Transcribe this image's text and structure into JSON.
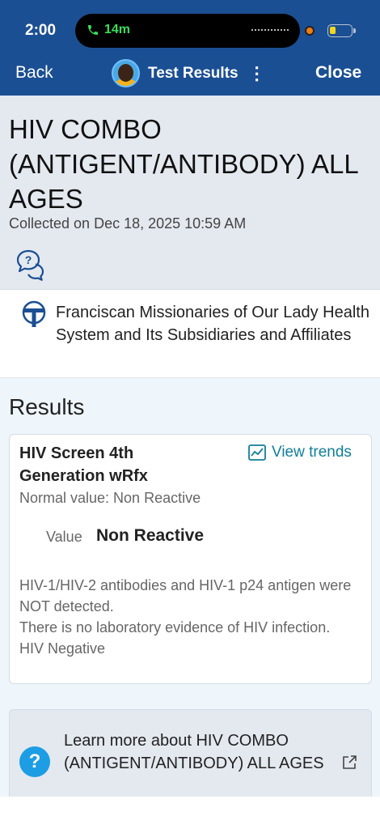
{
  "status_bar": {
    "time": "2:00",
    "call_duration": "14m",
    "icons": [
      "phone-icon",
      "camera-indicator",
      "battery-icon"
    ]
  },
  "nav": {
    "back_label": "Back",
    "title": "Test Results",
    "more_icon": "kebab-menu-icon",
    "close_label": "Close"
  },
  "test": {
    "title": "HIV COMBO (ANTIGENT/ANTIBODY) ALL AGES",
    "collected": "Collected on Dec 18, 2025 10:59 AM",
    "help_icon": "question-chat-icon"
  },
  "organization": {
    "name": "Franciscan Missionaries of Our Lady Health System and Its Subsidiaries and Affiliates",
    "logo_icon": "tau-cross-logo"
  },
  "results": {
    "heading": "Results",
    "components": [
      {
        "name": "HIV Screen 4th Generation wRfx",
        "trends_label": "View trends",
        "normal_value": "Normal value: Non Reactive",
        "value_label": "Value",
        "value": "Non Reactive",
        "comment_lines": [
          "HIV-1/HIV-2 antibodies and HIV-1 p24 antigen were NOT detected.",
          "There is no laboratory evidence of HIV infection.",
          "HIV Negative"
        ]
      }
    ]
  },
  "learn_more": {
    "text": "Learn more about HIV COMBO (ANTIGENT/ANTIBODY) ALL AGES",
    "icon": "question-circle-icon",
    "external_icon": "external-link-icon"
  },
  "colors": {
    "header_bg": "#1b4f93",
    "accent_teal": "#0f7f98",
    "help_blue": "#1d9de3",
    "panel_grey": "#e4e9f0",
    "results_bg": "#eef5fb"
  }
}
